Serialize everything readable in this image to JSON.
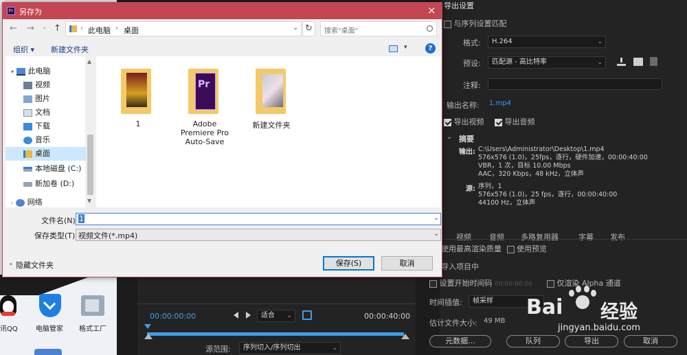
{
  "dialog": {
    "title": "另存为",
    "address": [
      "此电脑",
      "桌面"
    ],
    "search_placeholder": "搜索\"桌面\"",
    "toolbar": {
      "organize": "组织 ▾",
      "new_folder": "新建文件夹"
    },
    "tree": [
      {
        "label": "此电脑",
        "icon": "pc-icon"
      },
      {
        "label": "视频",
        "icon": "video-folder-icon"
      },
      {
        "label": "图片",
        "icon": "pictures-folder-icon"
      },
      {
        "label": "文档",
        "icon": "documents-folder-icon"
      },
      {
        "label": "下载",
        "icon": "downloads-folder-icon"
      },
      {
        "label": "音乐",
        "icon": "music-folder-icon"
      },
      {
        "label": "桌面",
        "icon": "desktop-folder-icon"
      },
      {
        "label": "本地磁盘 (C:)",
        "icon": "drive-c-icon"
      },
      {
        "label": "新加卷 (D:)",
        "icon": "drive-d-icon"
      },
      {
        "label": "网络",
        "icon": "network-icon"
      }
    ],
    "files": [
      {
        "name": "1"
      },
      {
        "name": "Adobe Premiere Pro Auto-Save"
      },
      {
        "name": "新建文件夹"
      }
    ],
    "filename_label": "文件名(N):",
    "filename_value": "1",
    "filetype_label": "保存类型(T):",
    "filetype_value": "视频文件(*.mp4)",
    "hide_folders": "隐藏文件夹",
    "save": "保存(S)",
    "cancel": "取消"
  },
  "export": {
    "header": "导出设置",
    "match_sequence": "与序列设置匹配",
    "format_label": "格式:",
    "format_value": "H.264",
    "preset_label": "预设:",
    "preset_value": "匹配源 - 高比特率",
    "comment_label": "注释:",
    "output_name_label": "输出名称:",
    "output_name_value": "1.mp4",
    "export_video": "导出视频",
    "export_audio": "导出音频",
    "summary_title": "摘要",
    "output_label": "输出:",
    "output_lines": [
      "C:\\Users\\Administrator\\Desktop\\1.mp4",
      "576x576 (1.0)，25fps，逐行，硬件加速，00:00:40:00",
      "VBR，1 次，目标 10.00 Mbps",
      "AAC，320 Kbps，48  kHz，立体声"
    ],
    "source_label": "源:",
    "source_lines": [
      "序列，1",
      "576x576 (1.0)，25 fps，逐行，00:00:40:00",
      "44100 Hz，立体声"
    ],
    "tabs": [
      "视频",
      "音频",
      "多路复用器",
      "字幕",
      "发布"
    ],
    "use_max_render": "使用最高渲染质量",
    "use_preview": "使用预览",
    "import_project": "导入项目中",
    "set_start_tc": "设置开始时间码",
    "start_tc_value": "00:00:00:00",
    "alpha_only": "仅渲染 Alpha 通道",
    "time_interp_label": "时间插值:",
    "time_interp_value": "帧采样",
    "est_size_label": "估计文件大小:",
    "est_size_value": "49 MB",
    "metadata_btn": "元数据...",
    "queue_btn": "队列",
    "export_btn": "导出",
    "cancel_btn": "取消"
  },
  "timeline": {
    "tc_left": "00:00:00:00",
    "tc_right": "00:00:40:00",
    "fit": "适合",
    "source_range_label": "源范围:",
    "source_range_value": "序列切入/序列切出"
  },
  "desktop": {
    "icons": [
      {
        "label": "讯QQ"
      },
      {
        "label": "电脑管家"
      },
      {
        "label": "格式工厂"
      }
    ]
  },
  "watermark": {
    "brand": "Bai",
    "brand2": "经验",
    "url": "jingyan.baidu.com"
  },
  "colors": {
    "accent": "#3d9eea",
    "title_bar": "#c44652"
  }
}
